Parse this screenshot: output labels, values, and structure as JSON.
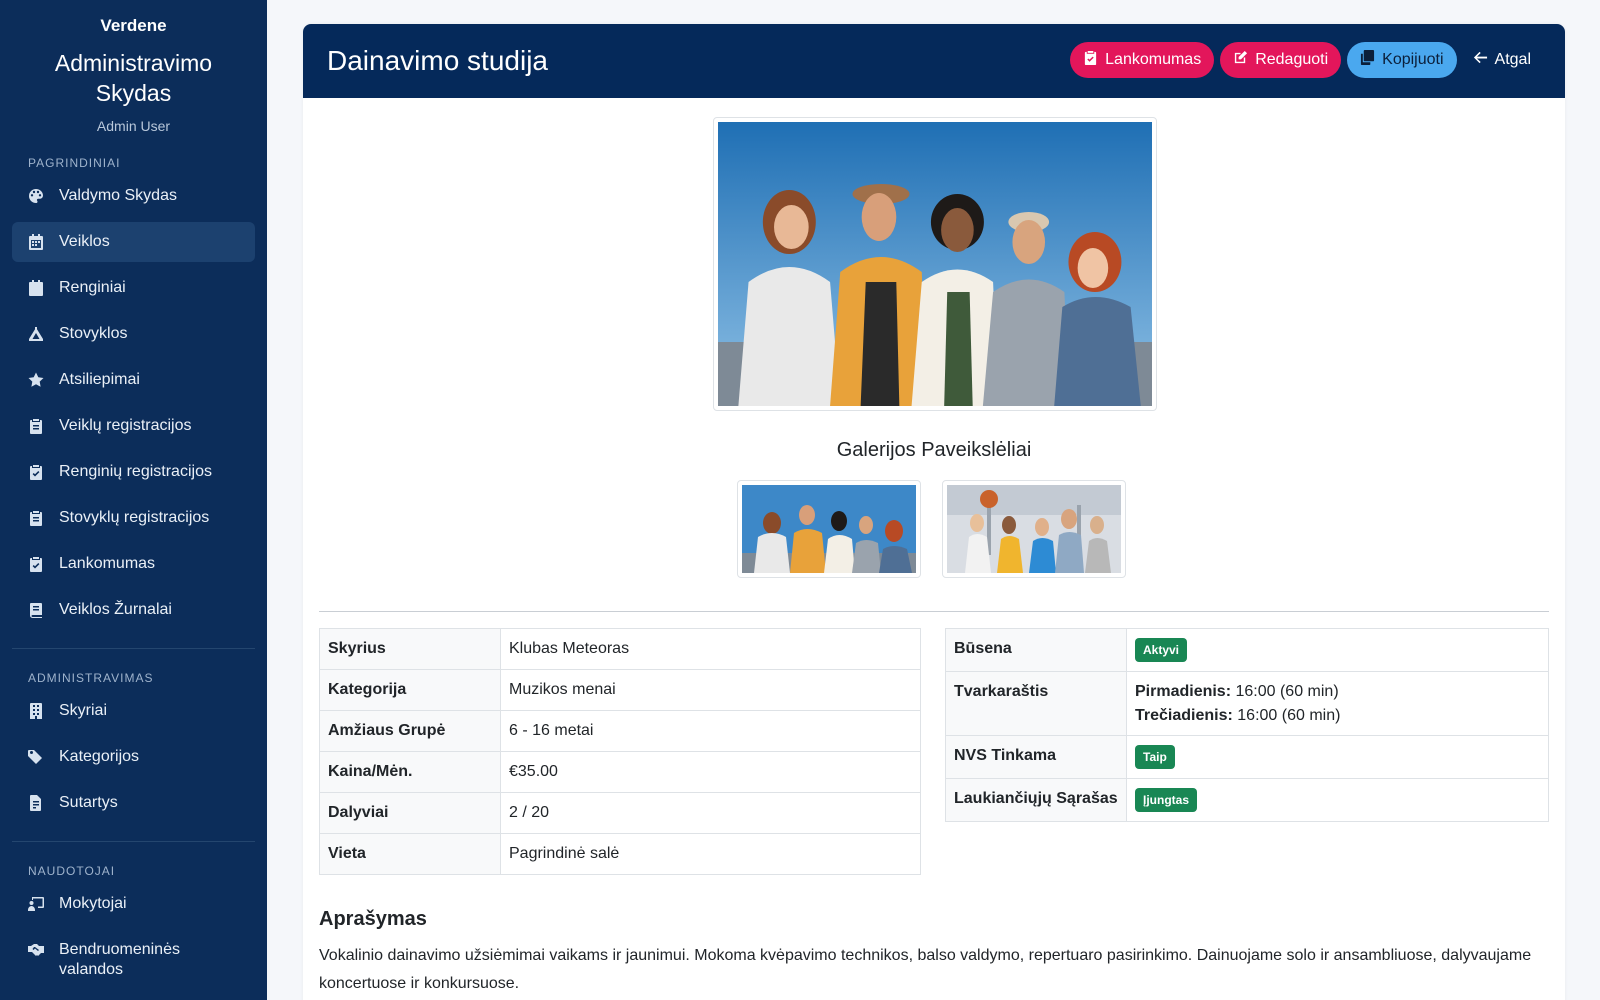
{
  "sidebar": {
    "org": "Verdene",
    "panel_title": "Administravimo Skydas",
    "user": "Admin User",
    "sections": {
      "main": "PAGRINDINIAI",
      "admin": "ADMINISTRAVIMAS",
      "users": "NAUDOTOJAI"
    },
    "main_items": [
      {
        "label": "Valdymo Skydas",
        "icon": "palette-icon"
      },
      {
        "label": "Veiklos",
        "icon": "calendar-icon",
        "active": true
      },
      {
        "label": "Renginiai",
        "icon": "calendar-star-icon"
      },
      {
        "label": "Stovyklos",
        "icon": "tent-icon"
      },
      {
        "label": "Atsiliepimai",
        "icon": "star-icon"
      },
      {
        "label": "Veiklų registracijos",
        "icon": "clipboard-icon"
      },
      {
        "label": "Renginių registracijos",
        "icon": "clipboard-check-icon"
      },
      {
        "label": "Stovyklų registracijos",
        "icon": "clipboard-list-icon"
      },
      {
        "label": "Lankomumas",
        "icon": "clipboard-check-icon"
      },
      {
        "label": "Veiklos Žurnalai",
        "icon": "book-icon"
      }
    ],
    "admin_items": [
      {
        "label": "Skyriai",
        "icon": "building-icon"
      },
      {
        "label": "Kategorijos",
        "icon": "tags-icon"
      },
      {
        "label": "Sutartys",
        "icon": "file-contract-icon"
      }
    ],
    "user_items": [
      {
        "label": "Mokytojai",
        "icon": "chalkboard-teacher-icon"
      },
      {
        "label": "Bendruomeninės valandos",
        "icon": "handshake-icon"
      }
    ]
  },
  "header": {
    "title": "Dainavimo studija",
    "buttons": {
      "attendance": "Lankomumas",
      "edit": "Redaguoti",
      "copy": "Kopijuoti",
      "back": "Atgal"
    }
  },
  "gallery": {
    "title": "Galerijos Paveikslėliai"
  },
  "details_left": [
    {
      "key": "Skyrius",
      "value": "Klubas Meteoras"
    },
    {
      "key": "Kategorija",
      "value": "Muzikos menai"
    },
    {
      "key": "Amžiaus Grupė",
      "value": "6 - 16 metai"
    },
    {
      "key": "Kaina/Mėn.",
      "value": "€35.00"
    },
    {
      "key": "Dalyviai",
      "value": "2 / 20"
    },
    {
      "key": "Vieta",
      "value": "Pagrindinė salė"
    }
  ],
  "details_right": {
    "status_label": "Būsena",
    "status_value": "Aktyvi",
    "schedule_label": "Tvarkaraštis",
    "schedule": [
      {
        "day": "Pirmadienis:",
        "time": "16:00 (60 min)"
      },
      {
        "day": "Trečiadienis:",
        "time": "16:00 (60 min)"
      }
    ],
    "nvs_label": "NVS Tinkama",
    "nvs_value": "Taip",
    "waitlist_label": "Laukiančiųjų Sąrašas",
    "waitlist_value": "Įjungtas"
  },
  "description": {
    "title": "Aprašymas",
    "text": "Vokalinio dainavimo užsiėmimai vaikams ir jaunimui. Mokoma kvėpavimo technikos, balso valdymo, repertuaro pasirinkimo. Dainuojame solo ir ansambliuose, dalyvaujame koncertuose ir konkursuose."
  },
  "colors": {
    "sidebar_bg": "#0c2d5a",
    "header_bg": "#05295a",
    "pink": "#e3165b",
    "blue": "#4aa8ef",
    "badge_green": "#198754"
  }
}
